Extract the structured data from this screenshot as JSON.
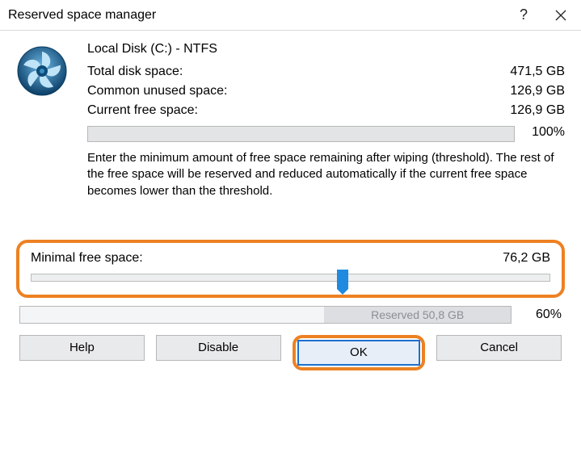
{
  "title": "Reserved space manager",
  "disk": {
    "title": "Local Disk (C:) - NTFS",
    "total_label": "Total disk space:",
    "total_value": "471,5 GB",
    "common_label": "Common unused space:",
    "common_value": "126,9 GB",
    "current_label": "Current free space:",
    "current_value": "126,9 GB",
    "current_pct": "100%"
  },
  "help_text": "Enter the minimum amount of free space remaining after wiping (threshold). The rest of the free space will be reserved and reduced automatically if the current free space becomes lower than the threshold.",
  "slider": {
    "label": "Minimal free space:",
    "value": "76,2 GB",
    "position_pct": 60
  },
  "reserved": {
    "label": "Reserved 50,8 GB",
    "pct": "60%"
  },
  "buttons": {
    "help": "Help",
    "disable": "Disable",
    "ok": "OK",
    "cancel": "Cancel"
  },
  "colors": {
    "highlight": "#ed8122",
    "primary": "#1f6fd0"
  }
}
